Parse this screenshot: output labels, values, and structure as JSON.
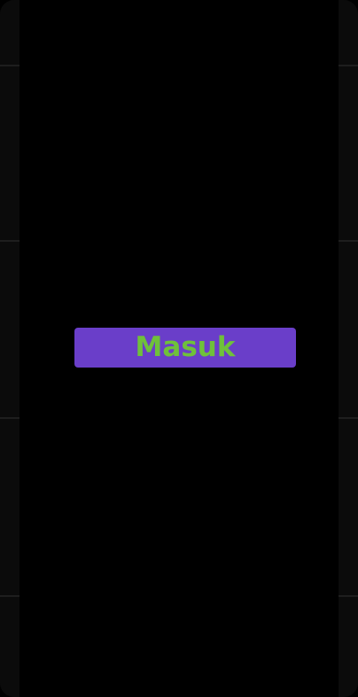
{
  "login_button": {
    "label": "Masuk"
  },
  "colors": {
    "screen_background": "#000000",
    "frame": "#0b0b0b",
    "button_background": "#6a3ec9",
    "button_text": "#6fc13a"
  }
}
